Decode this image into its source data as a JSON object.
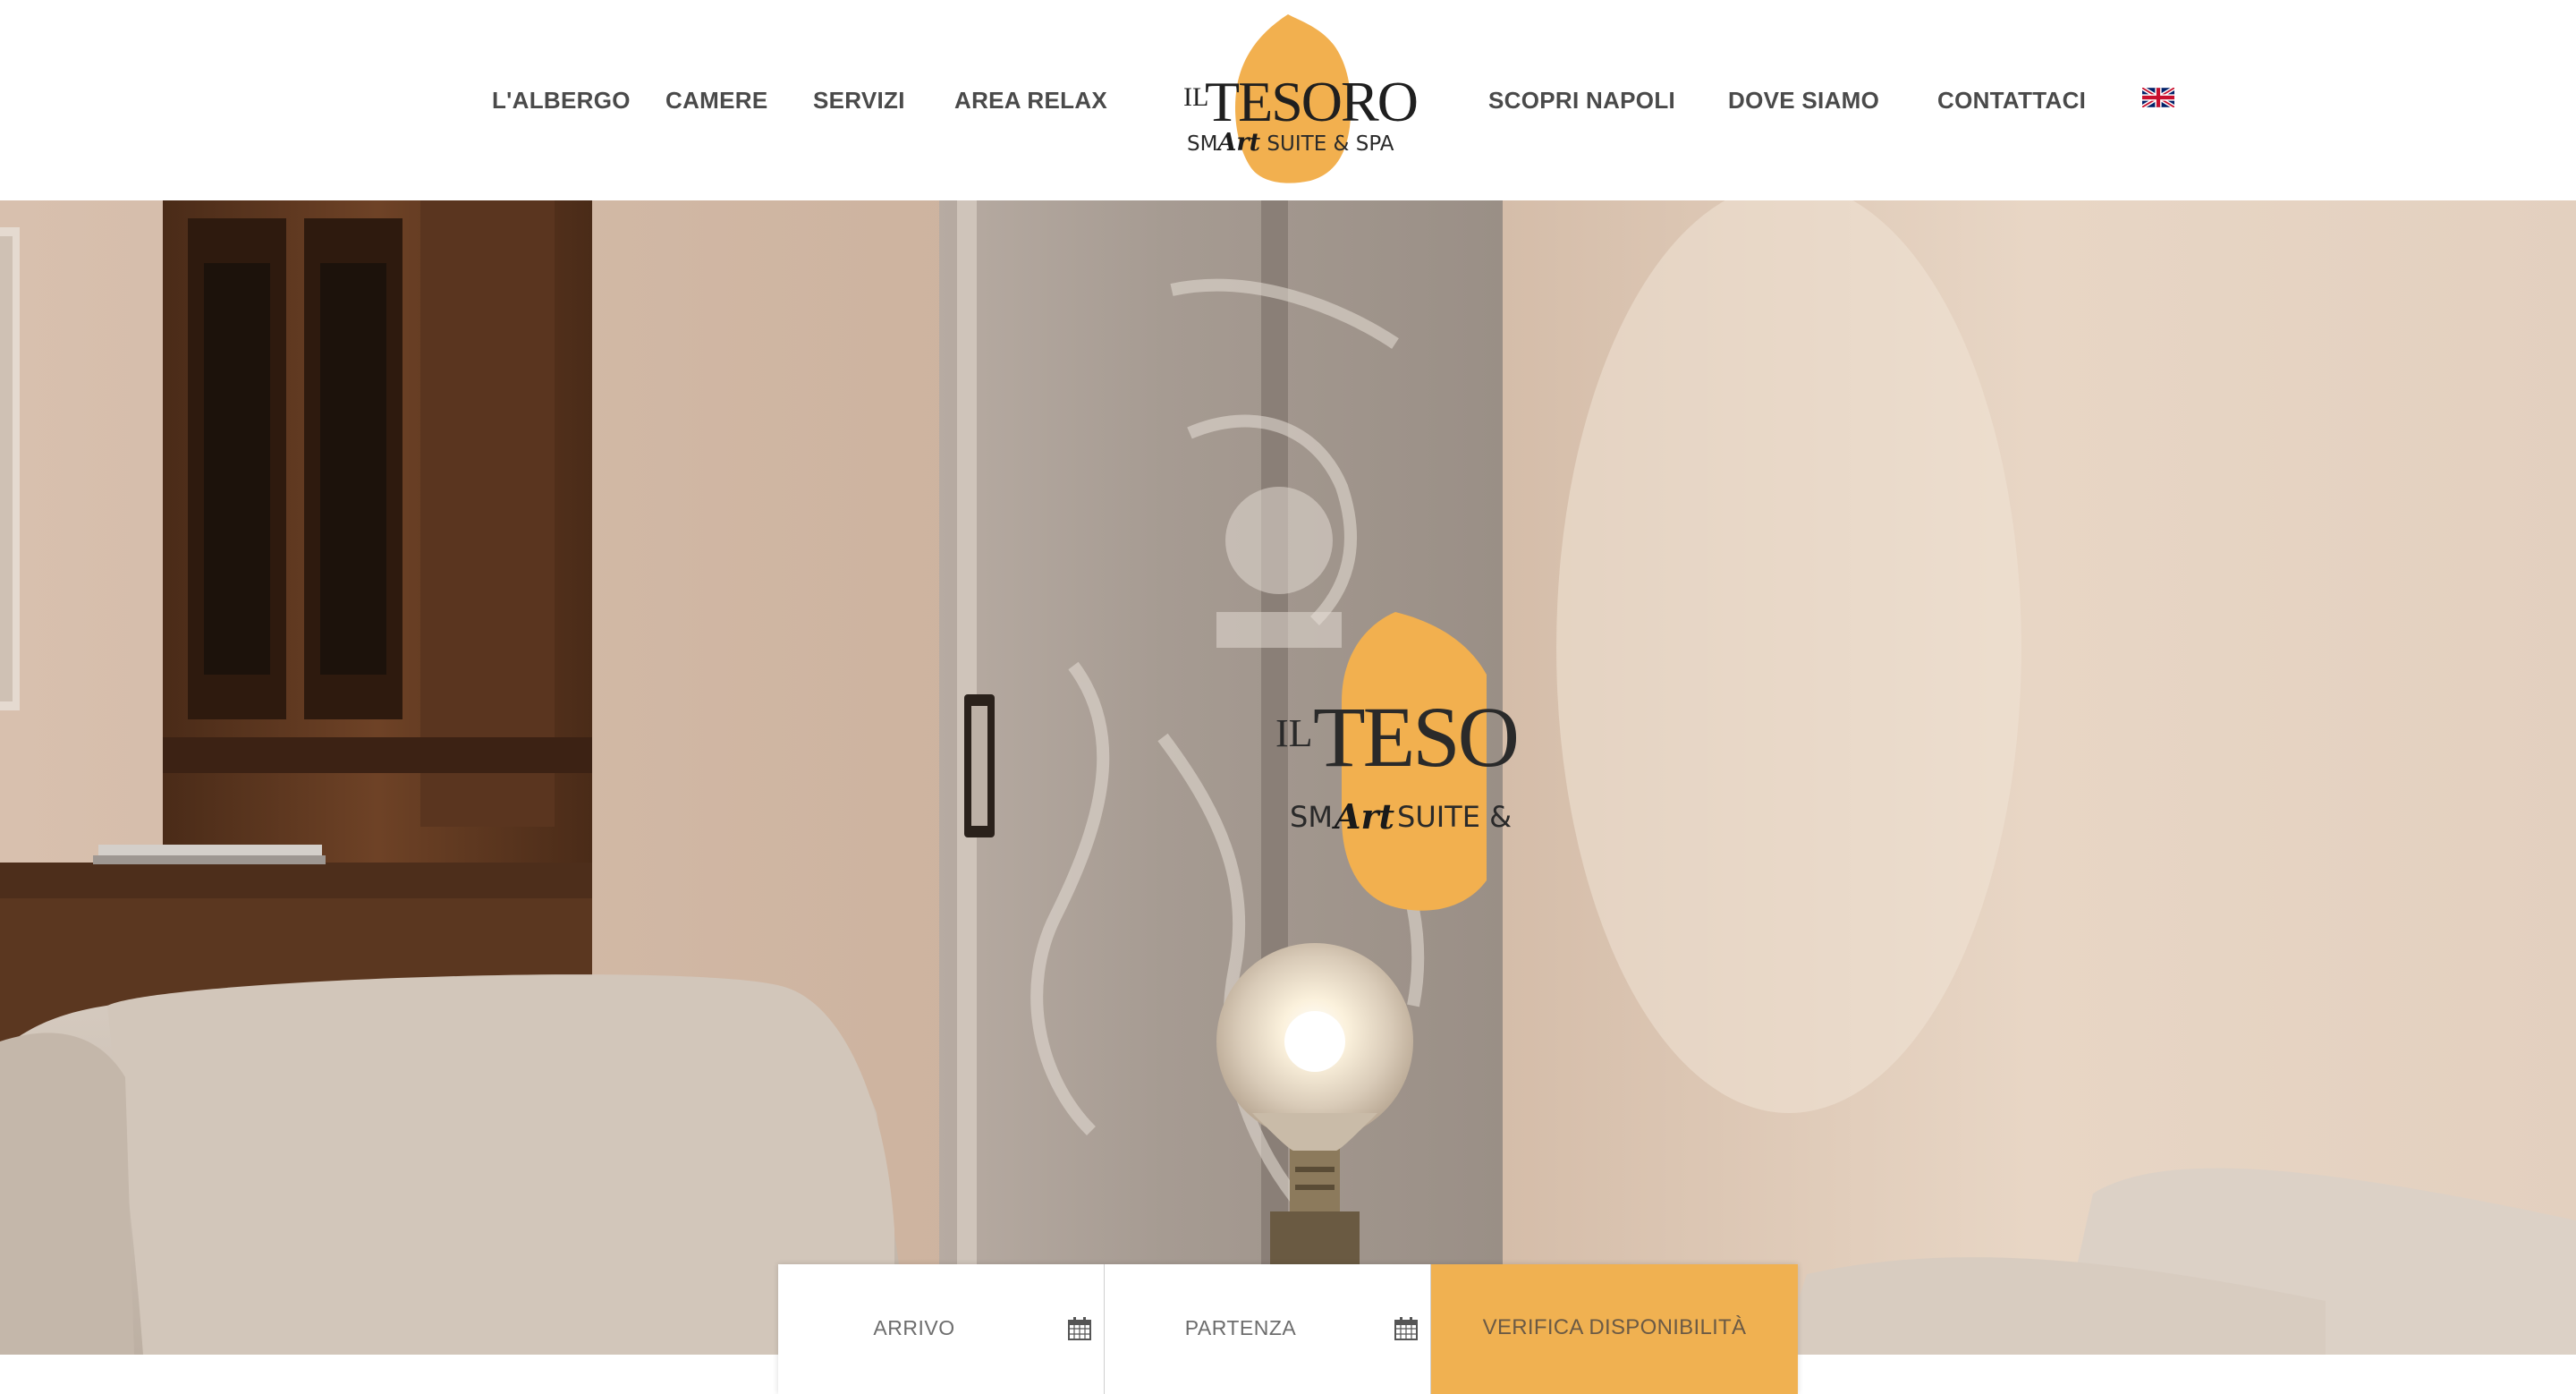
{
  "nav": {
    "left": [
      "L'ALBERGO",
      "CAMERE",
      "SERVIZI",
      "AREA RELAX"
    ],
    "right": [
      "SCOPRI NAPOLI",
      "DOVE SIAMO",
      "CONTATTACI"
    ]
  },
  "language_flag": "uk-flag-icon",
  "logo": {
    "il": "IL",
    "name": "TESORO",
    "sub_prefix": "SM",
    "sub_art": "Art",
    "sub_suffix": "SUITE & SPA",
    "accent_color": "#f2b04f"
  },
  "hero": {
    "sign_il": "IL",
    "sign_name": "TESO",
    "sign_sub_prefix": "SM",
    "sign_sub_art": "Art",
    "sign_sub_suffix": "SUITE &"
  },
  "booking": {
    "arrival_label": "ARRIVO",
    "departure_label": "PARTENZA",
    "submit_label": "VERIFICA DISPONIBILITÀ",
    "icon": "calendar-icon",
    "accent_color": "#f0b151"
  }
}
